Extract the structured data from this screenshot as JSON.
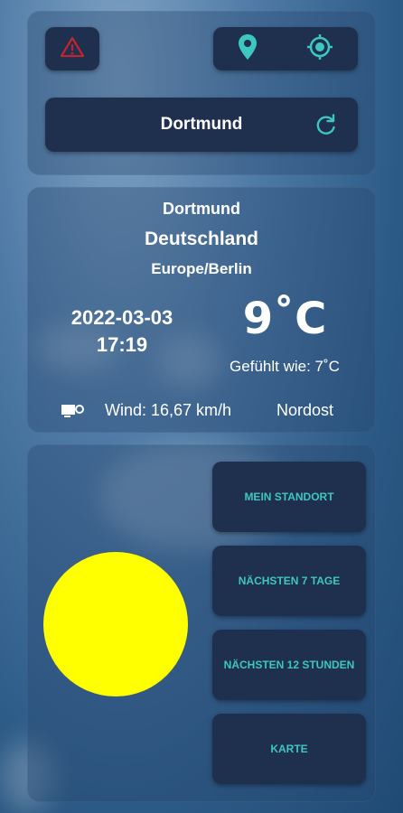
{
  "header": {
    "city_input": "Dortmund",
    "icons": {
      "warning": "warning-triangle-icon",
      "location": "location-pin-icon",
      "gps": "gps-target-icon",
      "refresh": "refresh-icon"
    }
  },
  "weather": {
    "city": "Dortmund",
    "country": "Deutschland",
    "timezone": "Europe/Berlin",
    "date": "2022-03-03",
    "time": "17:19",
    "temperature": "9˚C",
    "feels_like": "Gefühlt wie: 7˚C",
    "wind": "Wind: 16,67 km/h",
    "wind_direction": "Nordost"
  },
  "menu": {
    "my_location": "MEIN STANDORT",
    "next_7_days": "NÄCHSTEN 7 TAGE",
    "next_12_hours": "NÄCHSTEN 12 STUNDEN",
    "map": "KARTE"
  },
  "colors": {
    "accent": "#3ec6c0",
    "button_bg": "#1f2f4e",
    "warning": "#c0262d",
    "sun": "#ffff00"
  }
}
